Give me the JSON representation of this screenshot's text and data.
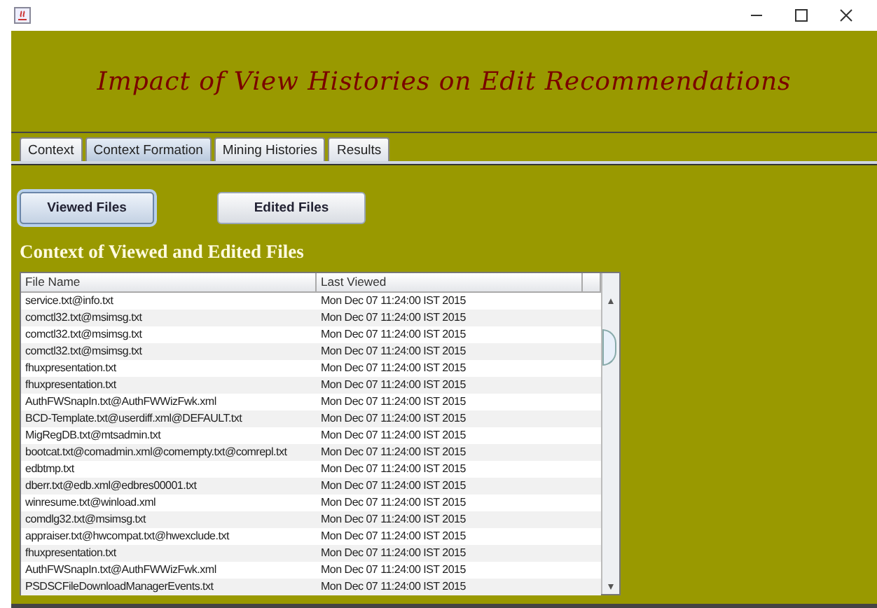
{
  "window": {
    "title": "Impact of View Histories on Edit Recommendations"
  },
  "tabs": [
    {
      "label": "Context",
      "selected": false
    },
    {
      "label": "Context Formation",
      "selected": true
    },
    {
      "label": "Mining Histories",
      "selected": false
    },
    {
      "label": "Results",
      "selected": false
    }
  ],
  "buttons": [
    {
      "label": "Viewed Files",
      "selected": true
    },
    {
      "label": "Edited Files",
      "selected": false
    }
  ],
  "section_title": "Context of Viewed and Edited Files",
  "table": {
    "columns": [
      "File Name",
      "Last Viewed"
    ],
    "rows": [
      [
        "service.txt@info.txt",
        "Mon Dec 07 11:24:00 IST 2015"
      ],
      [
        "comctl32.txt@msimsg.txt",
        "Mon Dec 07 11:24:00 IST 2015"
      ],
      [
        "comctl32.txt@msimsg.txt",
        "Mon Dec 07 11:24:00 IST 2015"
      ],
      [
        "comctl32.txt@msimsg.txt",
        "Mon Dec 07 11:24:00 IST 2015"
      ],
      [
        "fhuxpresentation.txt",
        "Mon Dec 07 11:24:00 IST 2015"
      ],
      [
        "fhuxpresentation.txt",
        "Mon Dec 07 11:24:00 IST 2015"
      ],
      [
        "AuthFWSnapIn.txt@AuthFWWizFwk.xml",
        "Mon Dec 07 11:24:00 IST 2015"
      ],
      [
        "BCD-Template.txt@userdiff.xml@DEFAULT.txt",
        "Mon Dec 07 11:24:00 IST 2015"
      ],
      [
        "MigRegDB.txt@mtsadmin.txt",
        "Mon Dec 07 11:24:00 IST 2015"
      ],
      [
        "bootcat.txt@comadmin.xml@comempty.txt@comrepl.txt",
        "Mon Dec 07 11:24:00 IST 2015"
      ],
      [
        "edbtmp.txt",
        "Mon Dec 07 11:24:00 IST 2015"
      ],
      [
        "dberr.txt@edb.xml@edbres00001.txt",
        "Mon Dec 07 11:24:00 IST 2015"
      ],
      [
        "winresume.txt@winload.xml",
        "Mon Dec 07 11:24:00 IST 2015"
      ],
      [
        "comdlg32.txt@msimsg.txt",
        "Mon Dec 07 11:24:00 IST 2015"
      ],
      [
        "appraiser.txt@hwcompat.txt@hwexclude.txt",
        "Mon Dec 07 11:24:00 IST 2015"
      ],
      [
        "fhuxpresentation.txt",
        "Mon Dec 07 11:24:00 IST 2015"
      ],
      [
        "AuthFWSnapIn.txt@AuthFWWizFwk.xml",
        "Mon Dec 07 11:24:00 IST 2015"
      ],
      [
        "PSDSCFileDownloadManagerEvents.txt",
        "Mon Dec 07 11:24:00 IST 2015"
      ]
    ]
  }
}
